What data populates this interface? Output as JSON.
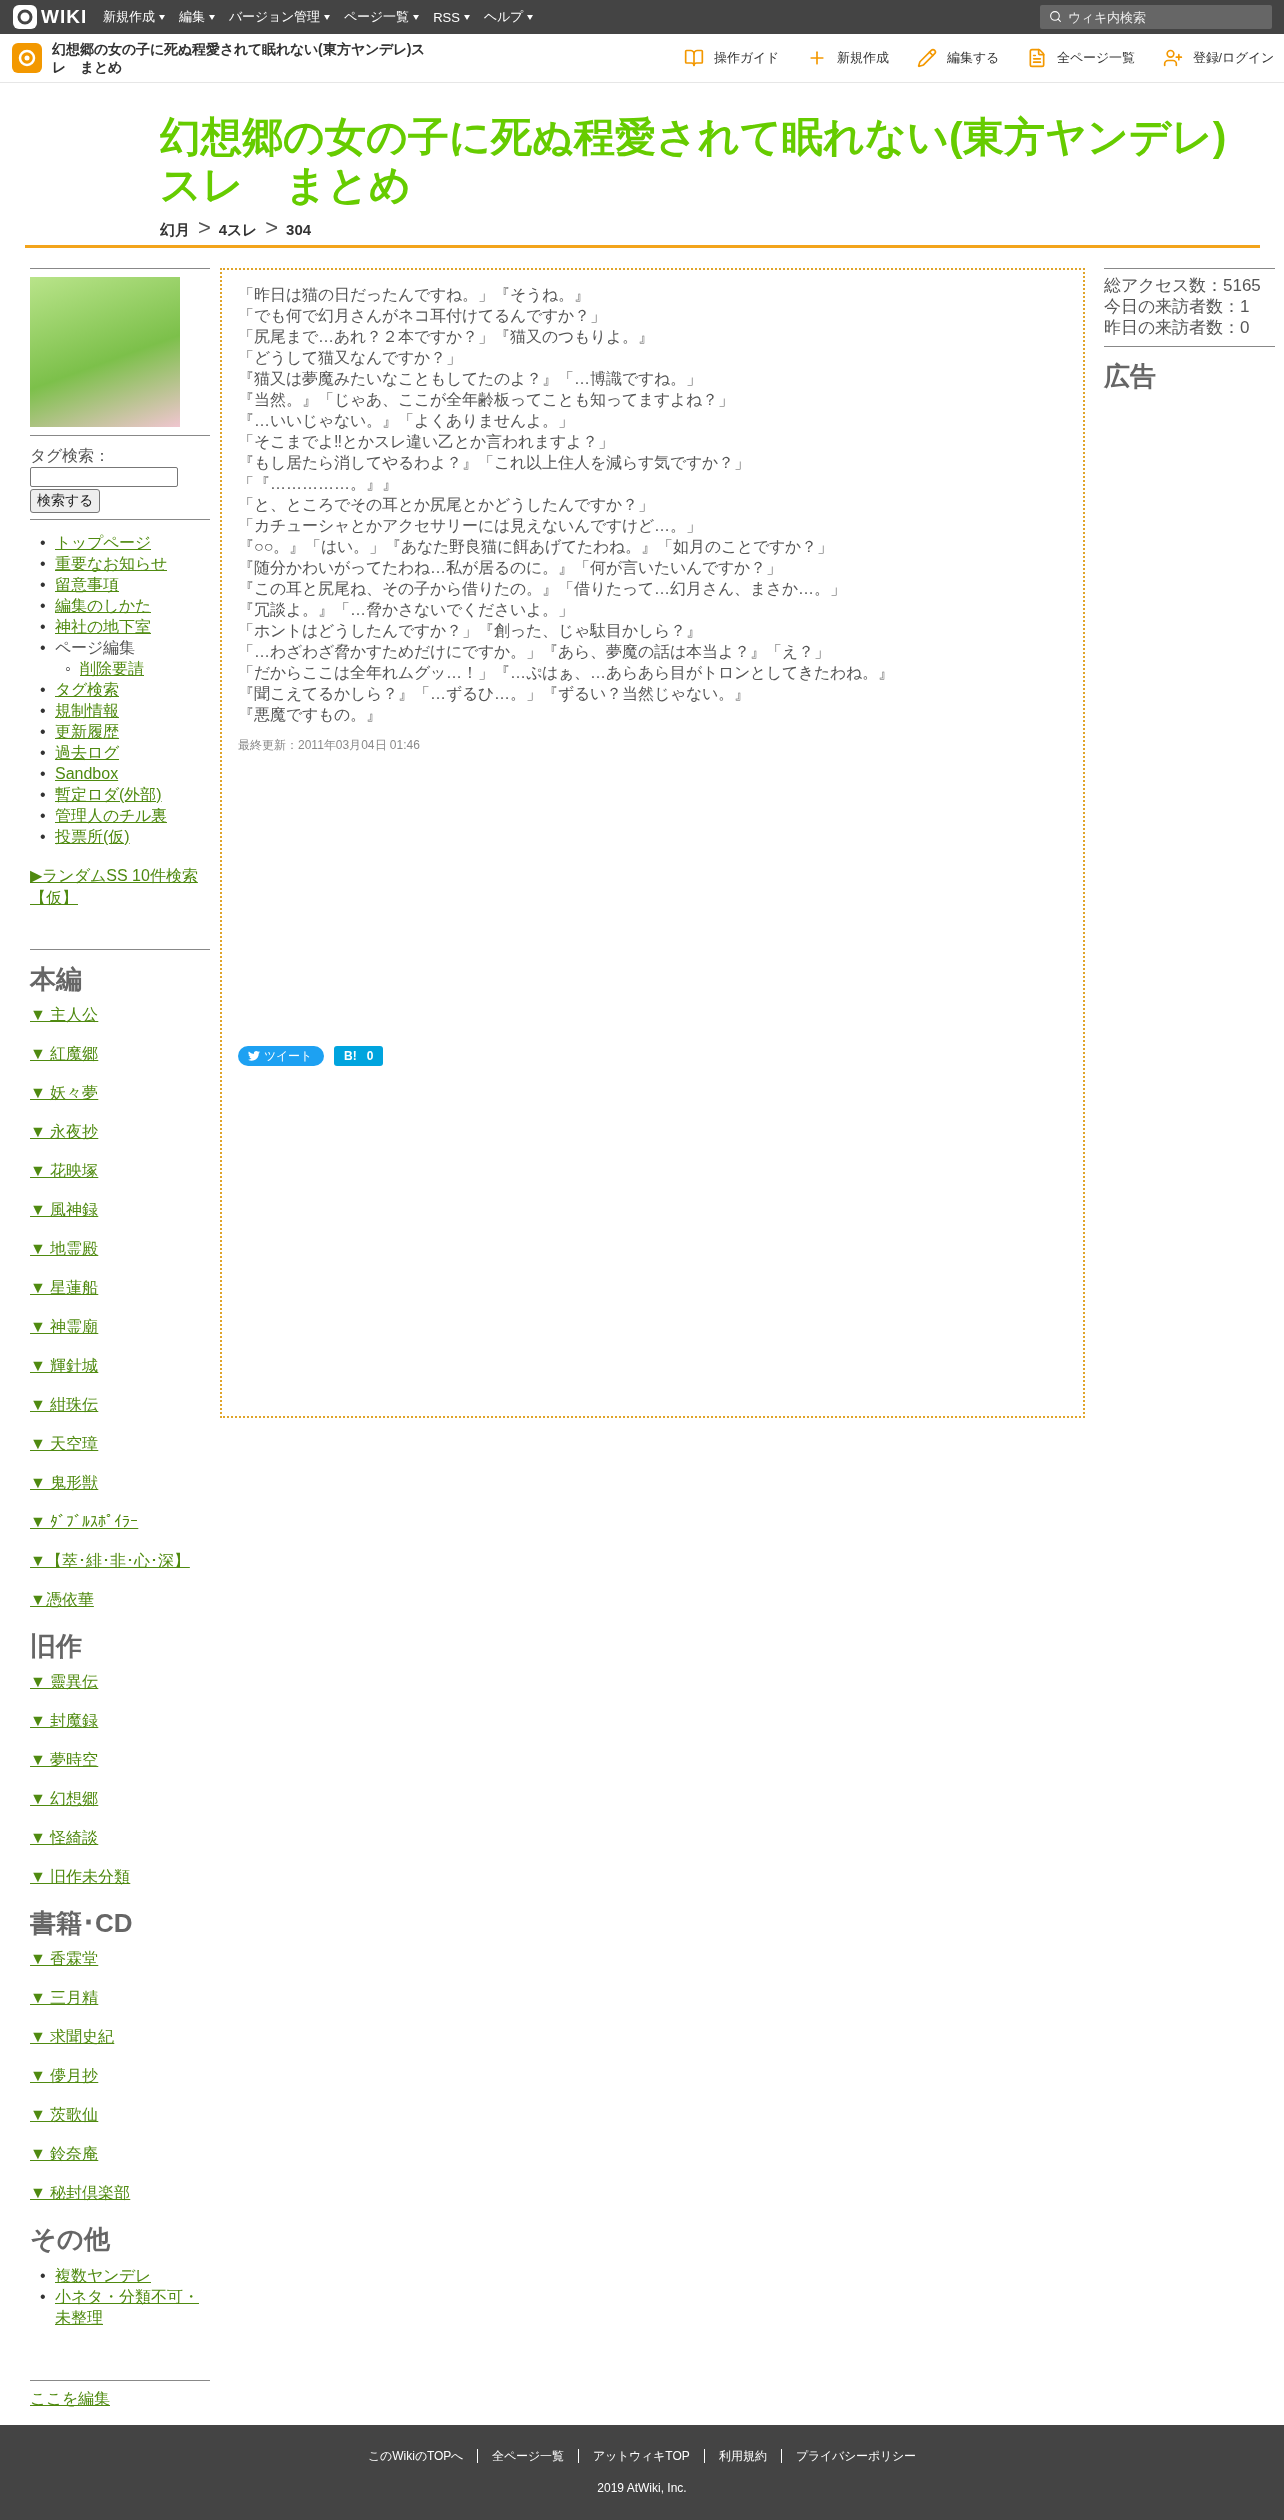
{
  "top_bar": {
    "logo_text": "WIKI",
    "menu": [
      "新規作成",
      "編集",
      "バージョン管理",
      "ページ一覧",
      "RSS",
      "ヘルプ"
    ],
    "search": {
      "placeholder": "ウィキ内検索"
    }
  },
  "header": {
    "site_title": "幻想郷の女の子に死ぬ程愛されて眠れない(東方ヤンデレ)スレ　まとめ",
    "actions": [
      "操作ガイド",
      "新規作成",
      "編集する",
      "全ページ一覧",
      "登録/ログイン"
    ]
  },
  "page_title": "幻想郷の女の子に死ぬ程愛されて眠れない(東方ヤンデレ)スレ　まとめ",
  "breadcrumb": [
    {
      "kind": "item",
      "text": "幻月"
    },
    {
      "kind": "separator",
      "text": ">"
    },
    {
      "kind": "item",
      "text": "4スレ"
    },
    {
      "kind": "separator",
      "text": ">"
    },
    {
      "kind": "item",
      "text": "304"
    }
  ],
  "sidebar": {
    "tag_search_label": "タグ検索：",
    "tag_search_button": "検索する",
    "menu": [
      {
        "marker": "•",
        "label": "トップページ",
        "link": true
      },
      {
        "marker": "•",
        "label": "重要なお知らせ",
        "link": true
      },
      {
        "marker": "•",
        "label": "留意事項",
        "link": true
      },
      {
        "marker": "•",
        "label": "編集のしかた",
        "link": true
      },
      {
        "marker": "•",
        "label": "神社の地下室",
        "link": true
      },
      {
        "marker": "•",
        "label": "ページ編集",
        "link": false,
        "children": [
          {
            "marker": "◦",
            "label": "削除要請",
            "link": true
          }
        ]
      },
      {
        "marker": "•",
        "label": "タグ検索",
        "link": true
      },
      {
        "marker": "•",
        "label": "規制情報",
        "link": true
      },
      {
        "marker": "•",
        "label": "更新履歴",
        "link": true
      },
      {
        "marker": "•",
        "label": "過去ログ",
        "link": true
      },
      {
        "marker": "•",
        "label": "Sandbox",
        "link": true
      },
      {
        "marker": "•",
        "label": "暫定ロダ(外部)",
        "link": true
      },
      {
        "marker": "•",
        "label": "管理人のチル裏",
        "link": true
      },
      {
        "marker": "•",
        "label": "投票所(仮)",
        "link": true
      }
    ],
    "random_link": "▶ランダムSS 10件検索【仮】",
    "sections": [
      {
        "heading": "本編",
        "kind": "links",
        "items": [
          "▼ 主人公",
          "▼ 紅魔郷",
          "▼ 妖々夢",
          "▼ 永夜抄",
          "▼ 花映塚",
          "▼ 風神録",
          "▼ 地霊殿",
          "▼ 星蓮船",
          "▼ 神霊廟",
          "▼ 輝針城",
          "▼ 紺珠伝",
          "▼ 天空璋",
          "▼ 鬼形獣",
          "▼ ﾀﾞﾌﾞﾙｽﾎﾟｲﾗｰ",
          "▼【萃･緋･非･心･深】",
          "▼憑依華"
        ]
      },
      {
        "heading": "旧作",
        "kind": "links",
        "items": [
          "▼ 靈異伝",
          "▼ 封魔録",
          "▼ 夢時空",
          "▼ 幻想郷",
          "▼ 怪綺談",
          "▼ 旧作未分類"
        ]
      },
      {
        "heading": "書籍･CD",
        "kind": "links",
        "items": [
          "▼ 香霖堂",
          "▼ 三月精",
          "▼ 求聞史紀",
          "▼ 儚月抄",
          "▼ 茨歌仙",
          "▼ 鈴奈庵",
          "▼ 秘封倶楽部"
        ]
      },
      {
        "heading": "その他",
        "kind": "bullets",
        "items": [
          {
            "marker": "•",
            "label": "複数ヤンデレ"
          },
          {
            "marker": "•",
            "label": "小ネタ・分類不可・未整理"
          }
        ]
      }
    ],
    "edit_link": "ここを編集"
  },
  "body_lines": [
    "「昨日は猫の日だったんですね。」『そうね。』",
    "「でも何で幻月さんがネコ耳付けてるんですか？」",
    "「尻尾まで…あれ？２本ですか？」『猫又のつもりよ。』",
    "「どうして猫又なんですか？」",
    "『猫又は夢魔みたいなこともしてたのよ？』「…博識ですね。」",
    "『当然。』「じゃあ、ここが全年齢板ってことも知ってますよね？」",
    "『…いいじゃない。』「よくありませんよ。」",
    "「そこまでよ‼とかスレ違い乙とか言われますよ？」",
    "『もし居たら消してやるわよ？』「これ以上住人を減らす気ですか？」",
    "「『……………。』』",
    "「と、ところでその耳とか尻尾とかどうしたんですか？」",
    "「カチューシャとかアクセサリーには見えないんですけど…。」",
    "『○○。』「はい。」『あなた野良猫に餌あげてたわね。』「如月のことですか？」",
    "『随分かわいがってたわね…私が居るのに。』「何が言いたいんですか？」",
    "『この耳と尻尾ね、その子から借りたの。』「借りたって…幻月さん、まさか…。」",
    "『冗談よ。』「…脅かさないでくださいよ。」",
    "「ホントはどうしたんですか？」『創った、じゃ駄目かしら？』",
    "「…わざわざ脅かすためだけにですか。」『あら、夢魔の話は本当よ？』「え？」",
    "「だからここは全年れムグッ…！」『…ぷはぁ、…あらあら目がトロンとしてきたわね。』",
    "『聞こえてるかしら？』「…ずるひ…。」『ずるい？当然じゃない。』",
    "『悪魔ですもの。』"
  ],
  "last_updated": "最終更新：2011年03月04日 01:46",
  "share": {
    "tweet": "ツイート",
    "hatena_label": "B!",
    "hatena_count": "0"
  },
  "right": {
    "stats": [
      "総アクセス数：5165",
      "今日の来訪者数：1",
      "昨日の来訪者数：0"
    ],
    "ad_heading": "広告"
  },
  "footer": {
    "links": [
      "このWikiのTOPへ",
      "全ページ一覧",
      "アットウィキTOP",
      "利用規約",
      "プライバシーポリシー"
    ],
    "copyright": "2019 AtWiki, Inc."
  }
}
